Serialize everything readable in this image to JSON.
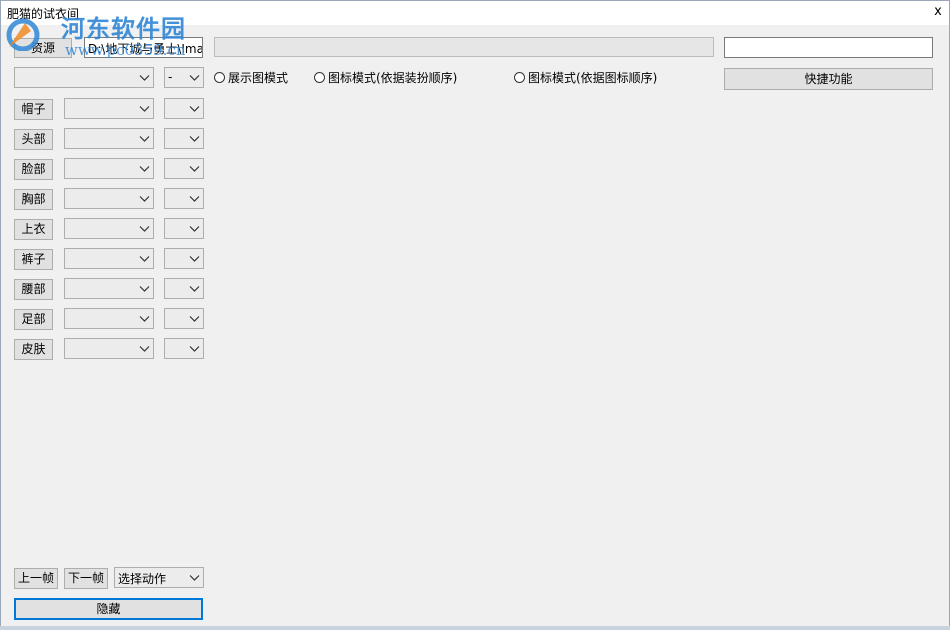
{
  "window": {
    "title": "肥猫的试衣间",
    "close_glyph": "x"
  },
  "watermark": {
    "brand": "河东软件园",
    "url": "www.pc0359.cn"
  },
  "toolbar": {
    "resource_label": "资源",
    "path_value": "D:\\地下城与勇士\\Imag",
    "shortcut_label": "快捷功能"
  },
  "top_combo": {
    "value": "",
    "small_value": "-"
  },
  "modes": [
    {
      "label": "展示图模式"
    },
    {
      "label": "图标模式(依据装扮顺序)"
    },
    {
      "label": "图标模式(依据图标顺序)"
    }
  ],
  "parts": [
    {
      "label": "帽子"
    },
    {
      "label": "头部"
    },
    {
      "label": "脸部"
    },
    {
      "label": "胸部"
    },
    {
      "label": "上衣"
    },
    {
      "label": "裤子"
    },
    {
      "label": "腰部"
    },
    {
      "label": "足部"
    },
    {
      "label": "皮肤"
    }
  ],
  "footer": {
    "prev_frame": "上一帧",
    "next_frame": "下一帧",
    "action_value": "选择动作",
    "hide_label": "隐藏"
  },
  "colors": {
    "window_bg": "#f0f0f0",
    "accent": "#0078d7",
    "watermark": "#2f86d6"
  }
}
